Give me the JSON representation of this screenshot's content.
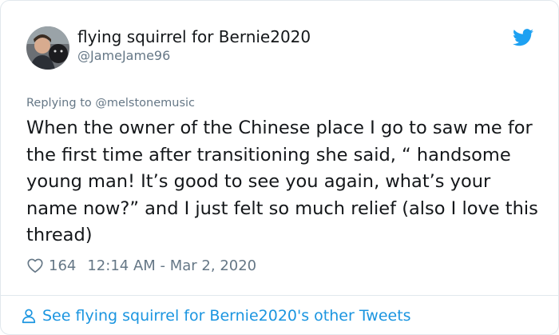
{
  "author": {
    "display_name": "flying squirrel for Bernie2020",
    "handle": "@JameJame96"
  },
  "reply": {
    "prefix": "Replying to",
    "mention": "@melstonemusic"
  },
  "tweet": {
    "text": "When the owner of the Chinese place I go to saw me for the first time after transitioning she said, “ handsome young man! It’s good to see you again, what’s your name now?” and I just felt so much relief (also I love this thread)"
  },
  "meta": {
    "likes": "164",
    "timestamp": "12:14 AM - Mar 2, 2020"
  },
  "footer": {
    "link_text": "See flying squirrel for Bernie2020's other Tweets"
  },
  "colors": {
    "link_blue": "#1b95e0",
    "twitter_blue": "#1da1f2",
    "muted_gray": "#657786"
  },
  "icons": {
    "brand": "twitter-bird-icon",
    "like": "heart-icon",
    "profile": "person-icon"
  }
}
